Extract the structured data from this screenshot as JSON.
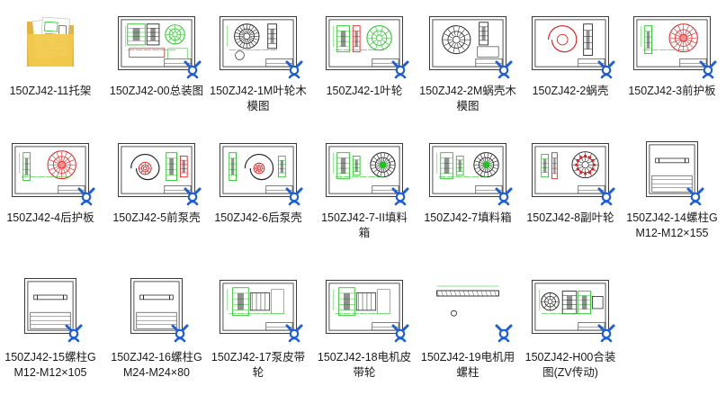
{
  "files": [
    {
      "name": "150ZJ42-11托架",
      "type": "folder",
      "icon": "folder-icon"
    },
    {
      "name": "150ZJ42-00总装图",
      "type": "drawing",
      "kind": "assembly",
      "icon": "cad-drawing-icon"
    },
    {
      "name": "150ZJ42-1M叶轮木模图",
      "type": "drawing",
      "kind": "impeller-pattern",
      "icon": "cad-drawing-icon"
    },
    {
      "name": "150ZJ42-1叶轮",
      "type": "drawing",
      "kind": "impeller",
      "icon": "cad-drawing-icon"
    },
    {
      "name": "150ZJ42-2M蜗壳木模图",
      "type": "drawing",
      "kind": "volute-pattern",
      "icon": "cad-drawing-icon"
    },
    {
      "name": "150ZJ42-2蜗壳",
      "type": "drawing",
      "kind": "volute",
      "icon": "cad-drawing-icon"
    },
    {
      "name": "150ZJ42-3前护板",
      "type": "drawing",
      "kind": "plate-red",
      "icon": "cad-drawing-icon"
    },
    {
      "name": "150ZJ42-4后护板",
      "type": "drawing",
      "kind": "plate-red",
      "icon": "cad-drawing-icon"
    },
    {
      "name": "150ZJ42-5前泵壳",
      "type": "drawing",
      "kind": "casing",
      "icon": "cad-drawing-icon"
    },
    {
      "name": "150ZJ42-6后泵壳",
      "type": "drawing",
      "kind": "casing2",
      "icon": "cad-drawing-icon"
    },
    {
      "name": "150ZJ42-7-II填料箱",
      "type": "drawing",
      "kind": "stuffing",
      "icon": "cad-drawing-icon"
    },
    {
      "name": "150ZJ42-7填料箱",
      "type": "drawing",
      "kind": "stuffing",
      "icon": "cad-drawing-icon"
    },
    {
      "name": "150ZJ42-8副叶轮",
      "type": "drawing",
      "kind": "aux-impeller",
      "icon": "cad-drawing-icon"
    },
    {
      "name": "150ZJ42-14螺柱GM12-M12×155",
      "type": "drawing",
      "kind": "stud-portrait",
      "icon": "cad-drawing-icon"
    },
    {
      "name": "150ZJ42-15螺柱GM12-M12×105",
      "type": "drawing",
      "kind": "stud-portrait",
      "icon": "cad-drawing-icon"
    },
    {
      "name": "150ZJ42-16螺柱GM24-M24×80",
      "type": "drawing",
      "kind": "stud-portrait",
      "icon": "cad-drawing-icon"
    },
    {
      "name": "150ZJ42-17泵皮带轮",
      "type": "drawing",
      "kind": "pulley",
      "icon": "cad-drawing-icon"
    },
    {
      "name": "150ZJ42-18电机皮带轮",
      "type": "drawing",
      "kind": "pulley",
      "icon": "cad-drawing-icon"
    },
    {
      "name": "150ZJ42-19电机用螺柱",
      "type": "drawing",
      "kind": "bolt-plain",
      "icon": "cad-drawing-icon"
    },
    {
      "name": "150ZJ42-H00合装图(ZV传动)",
      "type": "drawing",
      "kind": "assembly-v",
      "icon": "cad-drawing-icon"
    }
  ],
  "colors": {
    "cad_green": "#1fc21f",
    "cad_red": "#e02020",
    "cad_black": "#222222",
    "badge_blue": "#1e5fd6",
    "folder_yellow": "#f2c94c"
  }
}
